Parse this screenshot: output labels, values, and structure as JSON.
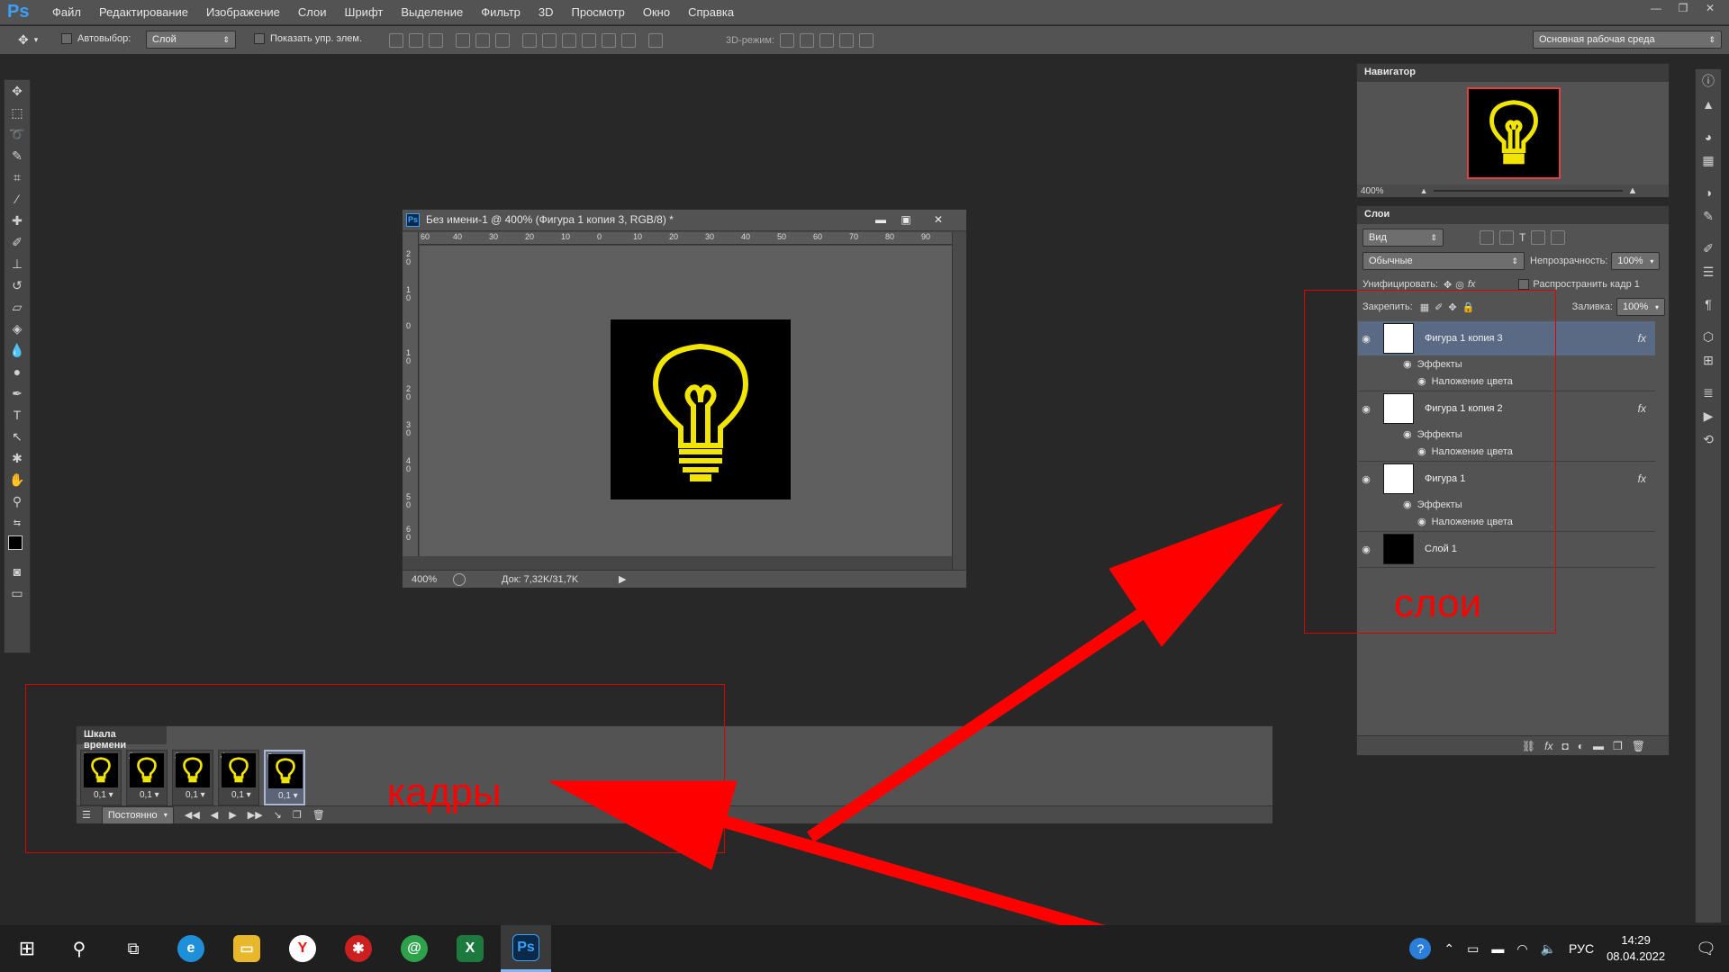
{
  "app": {
    "logo": "Ps",
    "menu": [
      "Файл",
      "Редактирование",
      "Изображение",
      "Слои",
      "Шрифт",
      "Выделение",
      "Фильтр",
      "3D",
      "Просмотр",
      "Окно",
      "Справка"
    ]
  },
  "options": {
    "autoselect_label": "Автовыбор:",
    "autoselect_value": "Слой",
    "show_controls_label": "Показать упр. элем.",
    "mode3d_label": "3D-режим:",
    "workspace": "Основная рабочая среда"
  },
  "document": {
    "title": "Без имени-1 @ 400% (Фигура 1 копия 3, RGB/8) *",
    "zoom": "400%",
    "doc_size": "Док: 7,32K/31,7K",
    "ruler_top": [
      "60",
      "40",
      "30",
      "20",
      "10",
      "0",
      "10",
      "20",
      "30",
      "40",
      "50",
      "60",
      "70",
      "80",
      "90"
    ],
    "ruler_left": [
      "2 0",
      "1 0",
      "0",
      "1 0",
      "2 0",
      "3 0",
      "4 0",
      "5 0",
      "6 0"
    ]
  },
  "navigator": {
    "title": "Навигатор",
    "zoom": "400%"
  },
  "layers": {
    "title": "Слои",
    "filter": "Вид",
    "blend_mode": "Обычные",
    "opacity_label": "Непрозрачность:",
    "opacity": "100%",
    "unify_label": "Унифицировать:",
    "propagate_label": "Распространить кадр 1",
    "lock_label": "Закрепить:",
    "fill_label": "Заливка:",
    "fill": "100%",
    "items": [
      {
        "name": "Фигура 1 копия 3",
        "effects": "Эффекты",
        "effect": "Наложение цвета",
        "fx": "fx"
      },
      {
        "name": "Фигура 1 копия 2",
        "effects": "Эффекты",
        "effect": "Наложение цвета",
        "fx": "fx"
      },
      {
        "name": "Фигура 1",
        "effects": "Эффекты",
        "effect": "Наложение цвета",
        "fx": "fx"
      },
      {
        "name": "Слой 1"
      }
    ]
  },
  "timeline": {
    "title": "Шкала времени",
    "frames": [
      {
        "num": "1",
        "delay": "0,1"
      },
      {
        "num": "2",
        "delay": "0,1"
      },
      {
        "num": "3",
        "delay": "0,1"
      },
      {
        "num": "4",
        "delay": "0,1"
      },
      {
        "num": "5",
        "delay": "0,1"
      }
    ],
    "loop": "Постоянно"
  },
  "annotations": {
    "frames_label": "кадры",
    "layers_label": "слои"
  },
  "taskbar": {
    "lang": "РУС",
    "time": "14:29",
    "date": "08.04.2022"
  },
  "colors": {
    "bulb": "#f2e600",
    "accent": "#3aa0ff",
    "annotation": "#ff0000"
  }
}
